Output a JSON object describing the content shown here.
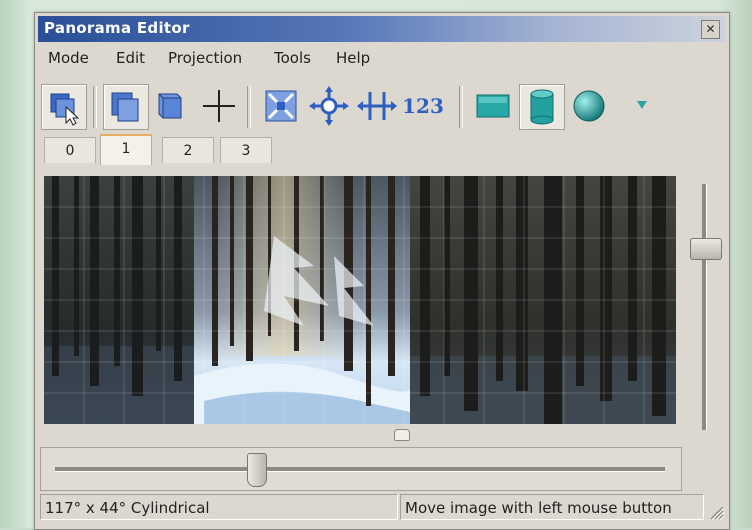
{
  "window": {
    "title": "Panorama Editor",
    "close_glyph": "✕"
  },
  "menu": [
    "Mode",
    "Edit",
    "Projection",
    "Tools",
    "Help"
  ],
  "toolbar": {
    "icons": [
      "move-image-mode-icon",
      "overlay-images-icon",
      "stack-images-icon",
      "crosshair-icon",
      "fit-panorama-icon",
      "center-panorama-icon",
      "straighten-horizon-icon",
      "numbers-icon",
      "rectilinear-projection-icon",
      "cylindrical-projection-icon",
      "spherical-projection-icon",
      "more-options-icon"
    ],
    "numbers_label": "123",
    "pressed": [
      "move-image-mode-icon",
      "overlay-images-icon",
      "cylindrical-projection-icon"
    ]
  },
  "tabs": {
    "items": [
      "0",
      "1",
      "2",
      "3"
    ],
    "active": "1"
  },
  "colors": {
    "title_start": "#2a4f96",
    "title_end": "#cdd3dd",
    "tab_active_accent": "#e6b060",
    "icon_blue": "#2d5fc2",
    "icon_teal": "#1f9a9a"
  },
  "sliders": {
    "vertical_position": 0.25,
    "horizontal_position": 0.33
  },
  "status": {
    "fov_text": "117° x 44° Cylindrical",
    "hint_text": "Move image with left mouse button"
  }
}
